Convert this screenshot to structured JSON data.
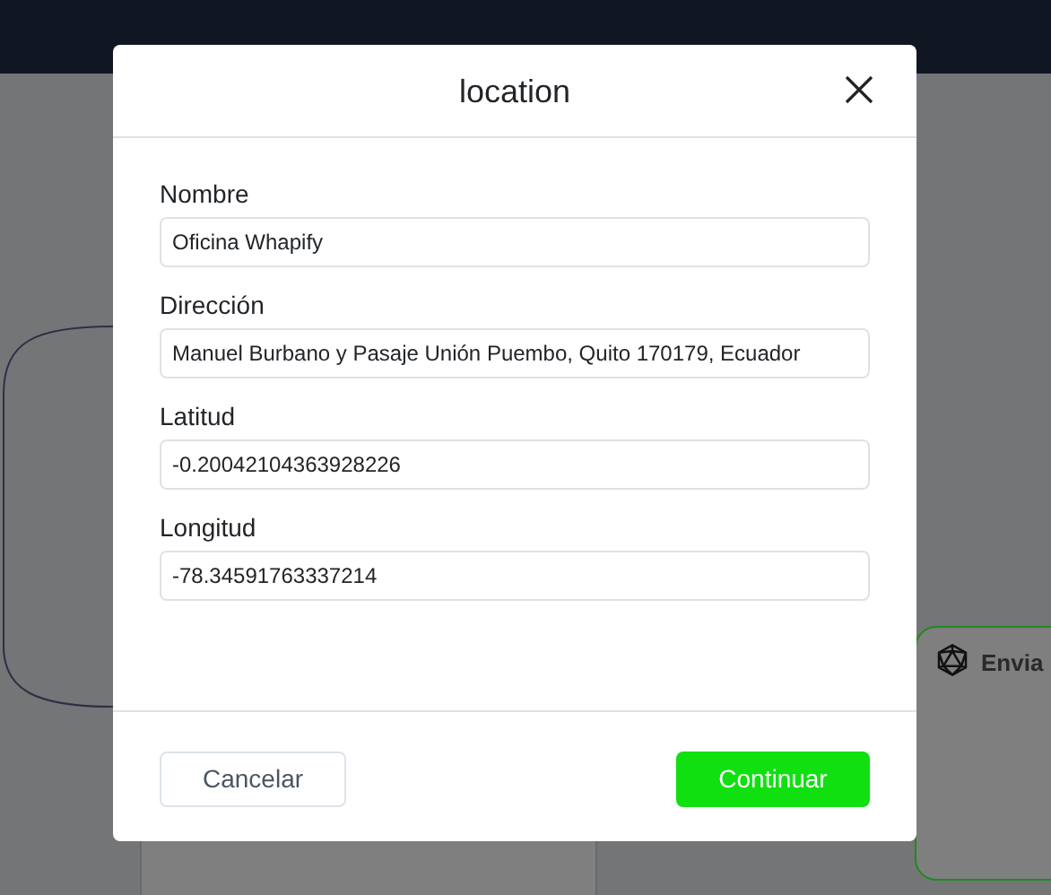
{
  "background_node": {
    "label": "Envia"
  },
  "dialog": {
    "title": "location",
    "fields": [
      {
        "label": "Nombre",
        "value": "Oficina Whapify"
      },
      {
        "label": "Dirección",
        "value": "Manuel Burbano y Pasaje Unión Puembo, Quito 170179, Ecuador"
      },
      {
        "label": "Latitud",
        "value": "-0.20042104363928226"
      },
      {
        "label": "Longitud",
        "value": "-78.34591763337214"
      }
    ],
    "buttons": [
      {
        "kind": "secondary",
        "label": "Cancelar"
      },
      {
        "kind": "primary",
        "label": "Continuar"
      }
    ]
  }
}
